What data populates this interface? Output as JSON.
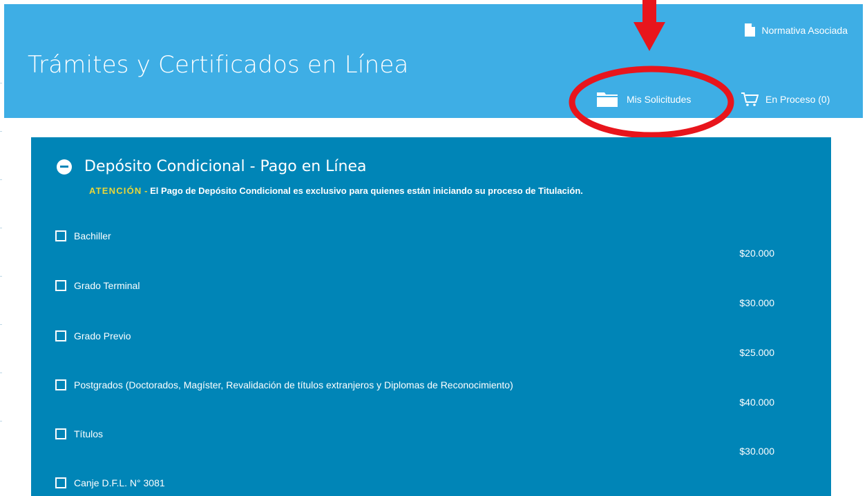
{
  "header": {
    "title": "Trámites y Certificados en Línea",
    "normativa_label": "Normativa Asociada",
    "solicitudes_label": "Mis Solicitudes",
    "proceso_label": "En Proceso (0)"
  },
  "panel": {
    "title": "Depósito Condicional - Pago en Línea",
    "warning_label": "ATENCIÓN",
    "warning_dash": " - ",
    "warning_text": "El Pago de Depósito Condicional es exclusivo para quienes están iniciando su proceso de Titulación.",
    "items": [
      {
        "label": "Bachiller",
        "price": "$20.000"
      },
      {
        "label": "Grado Terminal",
        "price": "$30.000"
      },
      {
        "label": "Grado Previo",
        "price": "$25.000"
      },
      {
        "label": "Postgrados (Doctorados, Magíster, Revalidación de títulos extranjeros y Diplomas de Reconocimiento)",
        "price": "$40.000"
      },
      {
        "label": "Títulos",
        "price": "$30.000"
      },
      {
        "label": "Canje D.F.L. N° 3081",
        "price": ""
      }
    ]
  },
  "colors": {
    "header_bg": "#3eaee5",
    "panel_bg": "#0085b7",
    "warning_accent": "#e8d63a",
    "annotation_red": "#e8151c"
  },
  "icons": {
    "normativa": "document-icon",
    "solicitudes": "folder-icon",
    "proceso": "cart-icon",
    "collapse": "minus-circle-icon"
  }
}
